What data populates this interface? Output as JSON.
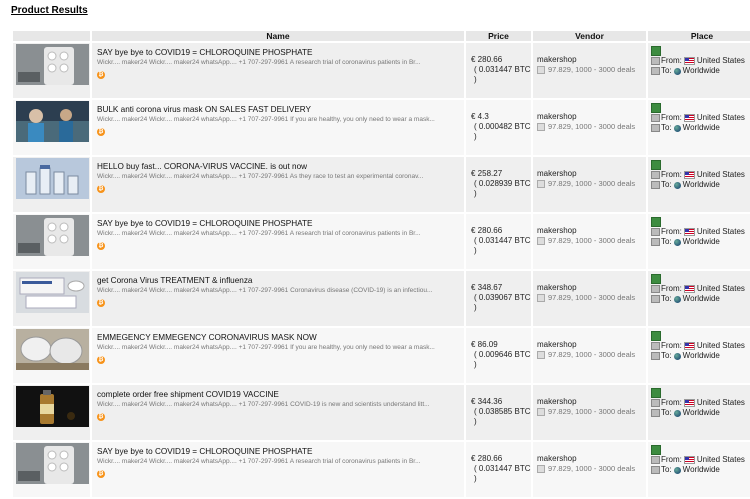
{
  "page": {
    "title": "Product Results"
  },
  "columns": {
    "name": "Name",
    "price": "Price",
    "vendor": "Vendor",
    "place": "Place"
  },
  "rows": [
    {
      "title": "SAY bye bye to COVID19 = CHLOROQUINE PHOSPHATE",
      "desc": "Wickr.... maker24 Wickr.... maker24 whatsApp.... +1 707-297-9961 A research trial of coronavirus patients in Br...",
      "price_eur": "€ 280.66",
      "price_btc": "( 0.031447 BTC )",
      "vendor": "makershop",
      "vendor_stats": "97.829, 1000 - 3000 deals",
      "from_label": "From:",
      "from": "United States",
      "to_label": "To:",
      "to": "Worldwide"
    },
    {
      "title": "BULK anti corona virus mask ON SALES FAST DELIVERY",
      "desc": "Wickr.... maker24 Wickr.... maker24 whatsApp.... +1 707-297-9961 If you are healthy, you only need to wear a mask...",
      "price_eur": "€ 4.3",
      "price_btc": "( 0.000482 BTC )",
      "vendor": "makershop",
      "vendor_stats": "97.829, 1000 - 3000 deals",
      "from_label": "From:",
      "from": "United States",
      "to_label": "To:",
      "to": "Worldwide"
    },
    {
      "title": "HELLO buy fast... CORONA-VIRUS VACCINE. is out now",
      "desc": "Wickr.... maker24 Wickr.... maker24 whatsApp.... +1 707-297-9961 As they race to test an experimental coronav...",
      "price_eur": "€ 258.27",
      "price_btc": "( 0.028939 BTC )",
      "vendor": "makershop",
      "vendor_stats": "97.829, 1000 - 3000 deals",
      "from_label": "From:",
      "from": "United States",
      "to_label": "To:",
      "to": "Worldwide"
    },
    {
      "title": "SAY bye bye to COVID19 = CHLOROQUINE PHOSPHATE",
      "desc": "Wickr.... maker24 Wickr.... maker24 whatsApp.... +1 707-297-9961 A research trial of coronavirus patients in Br...",
      "price_eur": "€ 280.66",
      "price_btc": "( 0.031447 BTC )",
      "vendor": "makershop",
      "vendor_stats": "97.829, 1000 - 3000 deals",
      "from_label": "From:",
      "from": "United States",
      "to_label": "To:",
      "to": "Worldwide"
    },
    {
      "title": "get Corona Virus TREATMENT & influenza",
      "desc": "Wickr.... maker24 Wickr.... maker24 whatsApp.... +1 707-297-9961 Coronavirus disease (COVID-19) is an infectiou...",
      "price_eur": "€ 348.67",
      "price_btc": "( 0.039067 BTC )",
      "vendor": "makershop",
      "vendor_stats": "97.829, 1000 - 3000 deals",
      "from_label": "From:",
      "from": "United States",
      "to_label": "To:",
      "to": "Worldwide"
    },
    {
      "title": "EMMEGENCY EMMEGENCY CORONAVIRUS MASK NOW",
      "desc": "Wickr.... maker24 Wickr.... maker24 whatsApp.... +1 707-297-9961 If you are healthy, you only need to wear a mask...",
      "price_eur": "€ 86.09",
      "price_btc": "( 0.009646 BTC )",
      "vendor": "makershop",
      "vendor_stats": "97.829, 1000 - 3000 deals",
      "from_label": "From:",
      "from": "United States",
      "to_label": "To:",
      "to": "Worldwide"
    },
    {
      "title": "complete order free shipment COVID19 VACCINE",
      "desc": "Wickr.... maker24 Wickr.... maker24 whatsApp.... +1 707-297-9961 COVID-19 is new and scientists understand litt...",
      "price_eur": "€ 344.36",
      "price_btc": "( 0.038585 BTC )",
      "vendor": "makershop",
      "vendor_stats": "97.829, 1000 - 3000 deals",
      "from_label": "From:",
      "from": "United States",
      "to_label": "To:",
      "to": "Worldwide"
    },
    {
      "title": "SAY bye bye to COVID19 = CHLOROQUINE PHOSPHATE",
      "desc": "Wickr.... maker24 Wickr.... maker24 whatsApp.... +1 707-297-9961 A research trial of coronavirus patients in Br...",
      "price_eur": "€ 280.66",
      "price_btc": "( 0.031447 BTC )",
      "vendor": "makershop",
      "vendor_stats": "97.829, 1000 - 3000 deals",
      "from_label": "From:",
      "from": "United States",
      "to_label": "To:",
      "to": "Worldwide"
    }
  ]
}
